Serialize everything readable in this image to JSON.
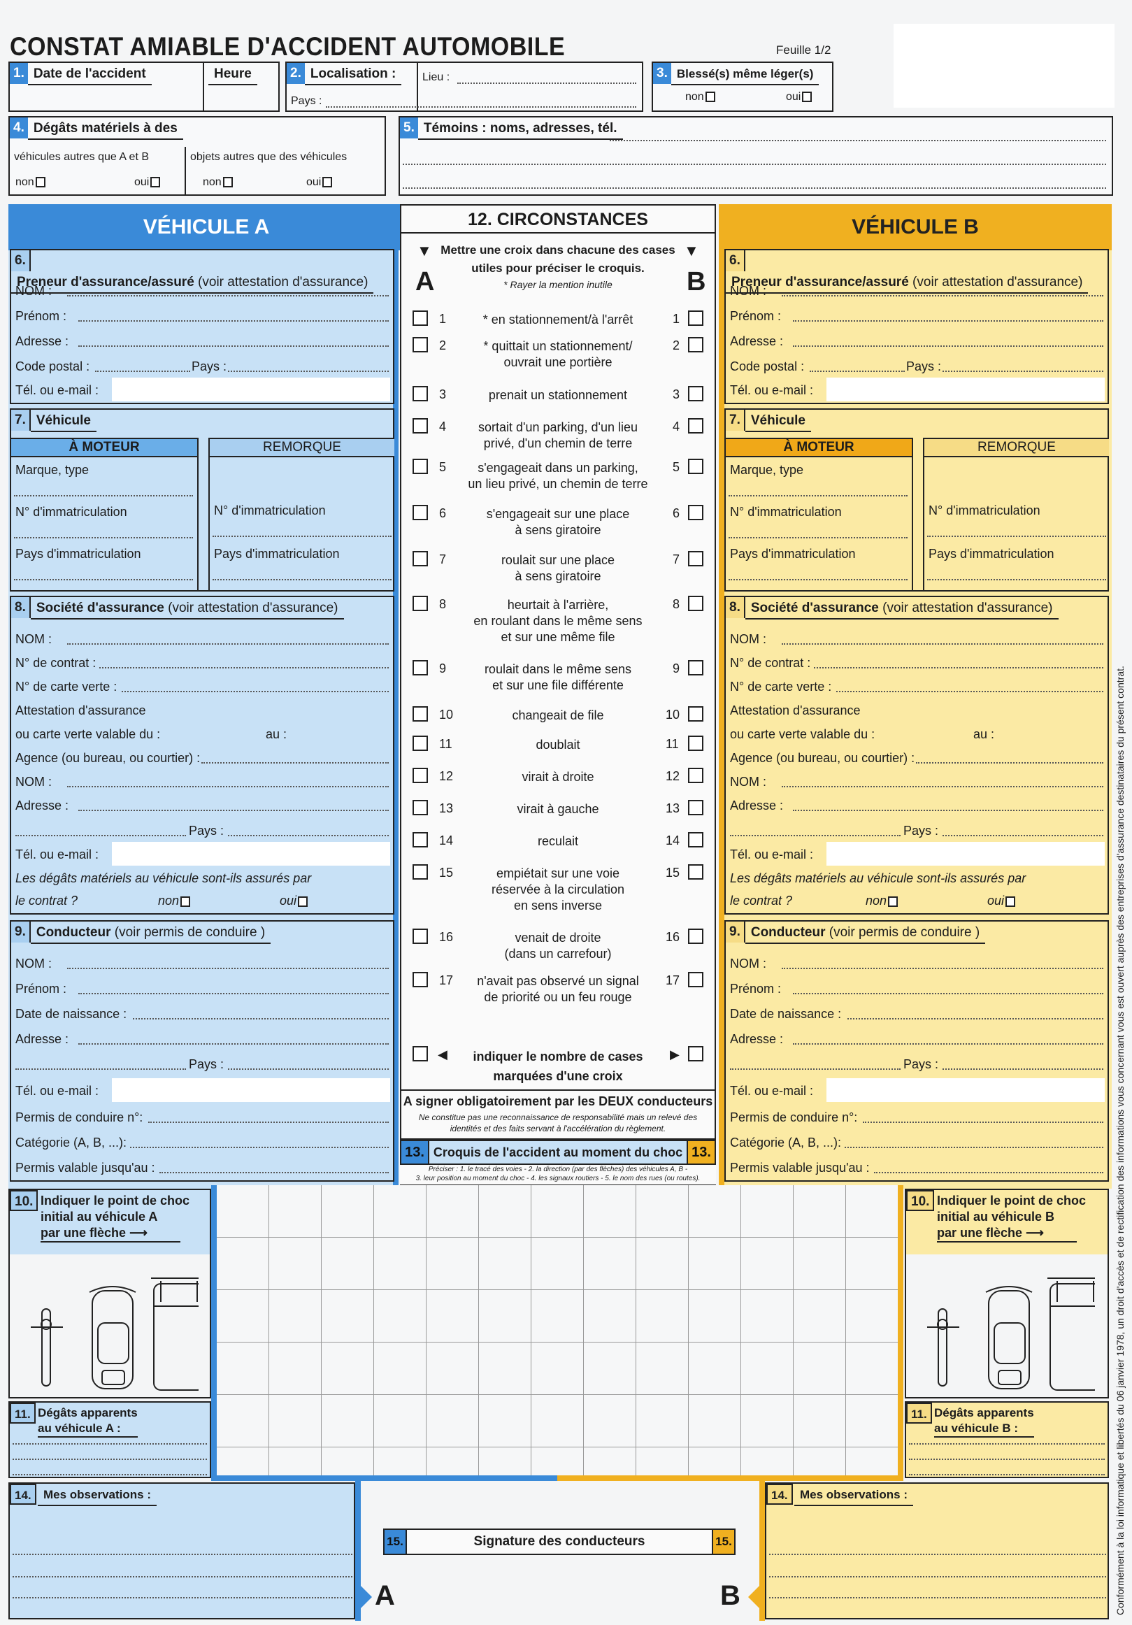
{
  "header": {
    "title": "CONSTAT AMIABLE D'ACCIDENT AUTOMOBILE",
    "sheet": "Feuille 1/2"
  },
  "s1": {
    "num": "1.",
    "label": "Date de l'accident",
    "heure": "Heure"
  },
  "s2": {
    "num": "2.",
    "label": "Localisation :",
    "lieu": "Lieu :",
    "pays": "Pays :"
  },
  "s3": {
    "num": "3.",
    "label": "Blessé(s) même léger(s)",
    "non": "non",
    "oui": "oui"
  },
  "s4": {
    "num": "4.",
    "label": "Dégâts matériels à des",
    "left": "véhicules autres que A et B",
    "right": "objets autres que des véhicules",
    "non": "non",
    "oui": "oui"
  },
  "s5": {
    "num": "5.",
    "label": "Témoins : noms, adresses, tél."
  },
  "vehA": {
    "title": "VÉHICULE A",
    "s6": {
      "num": "6.",
      "label": "Preneur d'assurance/assuré",
      "note": "(voir attestation d'assurance)"
    },
    "s7": {
      "num": "7.",
      "label": "Véhicule"
    },
    "s8": {
      "num": "8.",
      "label": "Société d'assurance",
      "note": "(voir attestation d'assurance)"
    },
    "s9": {
      "num": "9.",
      "label": "Conducteur",
      "note": "(voir permis de conduire )"
    },
    "s10": {
      "num": "10.",
      "l1": "Indiquer le point de choc",
      "l2": "initial au véhicule A",
      "l3": "par une flèche"
    },
    "s11": {
      "num": "11.",
      "l1": "Dégâts apparents",
      "l2": "au véhicule A :"
    },
    "s14": {
      "num": "14.",
      "label": "Mes observations :"
    },
    "letter": "A"
  },
  "vehB": {
    "title": "VÉHICULE B",
    "s6": {
      "num": "6.",
      "label": "Preneur d'assurance/assuré",
      "note": "(voir attestation d'assurance)"
    },
    "s7": {
      "num": "7.",
      "label": "Véhicule"
    },
    "s8": {
      "num": "8.",
      "label": "Société d'assurance",
      "note": "(voir attestation d'assurance)"
    },
    "s9": {
      "num": "9.",
      "label": "Conducteur",
      "note": "(voir permis de conduire )"
    },
    "s10": {
      "num": "10.",
      "l1": "Indiquer le point de choc",
      "l2": "initial au véhicule B",
      "l3": "par une flèche"
    },
    "s11": {
      "num": "11.",
      "l1": "Dégâts apparents",
      "l2": "au véhicule B :"
    },
    "s14": {
      "num": "14.",
      "label": "Mes observations :"
    },
    "letter": "B"
  },
  "fields": {
    "nom": "NOM :",
    "prenom": "Prénom :",
    "adresse": "Adresse :",
    "cp": "Code postal :",
    "pays": "Pays :",
    "tel": "Tél. ou e-mail :",
    "moteur": "À MOTEUR",
    "remorque": "REMORQUE",
    "marque": "Marque, type",
    "immat": "N° d'immatriculation",
    "paysImmat": "Pays d'immatriculation",
    "contrat": "N° de contrat :",
    "carteVerte": "N° de carte verte :",
    "attestation": "Attestation d'assurance",
    "valable": "ou carte verte valable du :",
    "au": "au :",
    "agence": "Agence (ou bureau, ou courtier) :",
    "degats1": "Les dégâts matériels au véhicule sont-ils assurés par",
    "degats2": "le contrat ?",
    "non": "non",
    "oui": "oui",
    "naissance": "Date de naissance :",
    "permis": "Permis de conduire n°:",
    "categorie": "Catégorie (A, B, ...):",
    "valide": "Permis valable jusqu'au :"
  },
  "circ": {
    "title": "12. CIRCONSTANCES",
    "instr1": "Mettre une croix dans chacune des cases",
    "instr2": "utiles pour préciser le croquis.",
    "instr3": "* Rayer la mention inutile",
    "colA": "A",
    "colB": "B",
    "items": [
      {
        "n": "1",
        "t": [
          "* en stationnement/à l'arrêt"
        ]
      },
      {
        "n": "2",
        "t": [
          "* quittait un stationnement/",
          "ouvrait une portière"
        ]
      },
      {
        "n": "3",
        "t": [
          "prenait un stationnement"
        ]
      },
      {
        "n": "4",
        "t": [
          "sortait d'un parking, d'un lieu",
          "privé, d'un chemin de terre"
        ]
      },
      {
        "n": "5",
        "t": [
          "s'engageait dans un parking,",
          "un lieu privé, un chemin de terre"
        ]
      },
      {
        "n": "6",
        "t": [
          "s'engageait sur une place",
          "à sens giratoire"
        ]
      },
      {
        "n": "7",
        "t": [
          "roulait sur une place",
          "à sens giratoire"
        ]
      },
      {
        "n": "8",
        "t": [
          "heurtait à l'arrière,",
          "en roulant dans le même sens",
          "et sur une même file"
        ]
      },
      {
        "n": "9",
        "t": [
          "roulait dans le même sens",
          "et sur une file différente"
        ]
      },
      {
        "n": "10",
        "t": [
          "changeait de file"
        ]
      },
      {
        "n": "11",
        "t": [
          "doublait"
        ]
      },
      {
        "n": "12",
        "t": [
          "virait à droite"
        ]
      },
      {
        "n": "13",
        "t": [
          "virait à gauche"
        ]
      },
      {
        "n": "14",
        "t": [
          "reculait"
        ]
      },
      {
        "n": "15",
        "t": [
          "empiétait sur une voie",
          "réservée à la circulation",
          "en sens inverse"
        ]
      },
      {
        "n": "16",
        "t": [
          "venait de droite",
          "(dans un carrefour)"
        ]
      },
      {
        "n": "17",
        "t": [
          "n'avait pas observé un signal",
          "de priorité ou un feu rouge"
        ]
      }
    ],
    "count1": "indiquer le nombre de cases",
    "count2": "marquées d'une croix"
  },
  "sign": {
    "bold": "A signer obligatoirement par les DEUX conducteurs",
    "note1": "Ne constitue pas une reconnaissance de responsabilité mais un relevé des",
    "note2": "identités et des faits servant à l'accélération du règlement."
  },
  "s13": {
    "num": "13.",
    "label": "Croquis de l'accident au moment du choc",
    "hint1": "Préciser : 1. le tracé des voies - 2. la direction (par des flèches) des véhicules A, B -",
    "hint2": "3. leur position au moment du choc - 4. les signaux routiers - 5. le nom des rues (ou routes)."
  },
  "s15": {
    "num": "15.",
    "label": "Signature des conducteurs"
  },
  "legal": "Conformément à la loi informatique et libertés du 06 janvier 1978, un droit d'accès et de rectification des informations vous concernant vous est ouvert auprès des entreprises d'assurance destinataires du présent contrat.",
  "colors": {
    "blue": "#3a8ad8",
    "lightBlue": "#c8e1f6",
    "orange": "#f0b020",
    "lightYellow": "#fbeaa4"
  }
}
